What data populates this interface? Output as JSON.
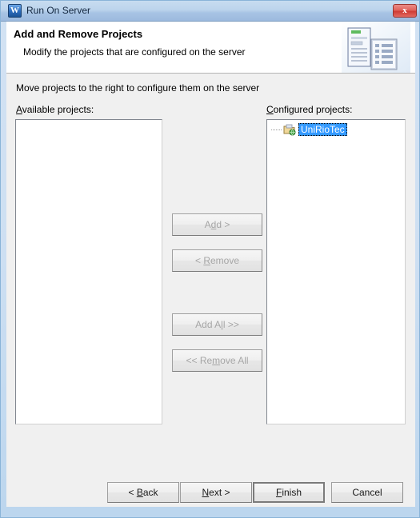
{
  "window": {
    "title": "Run On Server",
    "icon": "web-project-icon",
    "icon_glyph": "W",
    "close_label": "x",
    "close_icon": "close-icon"
  },
  "header": {
    "title": "Add and Remove Projects",
    "subtitle": "Modify the projects that are configured on the server",
    "art_icon": "server-and-document-icon"
  },
  "body": {
    "instruction": "Move projects to the right to configure them on the server",
    "available": {
      "label_pre": "",
      "label_mnemonic": "A",
      "label_post": "vailable projects:",
      "items": []
    },
    "configured": {
      "label_pre": "",
      "label_mnemonic": "C",
      "label_post": "onfigured projects:",
      "items": [
        {
          "name": "UniRioTec",
          "icon": "web-project-icon",
          "selected": true
        }
      ]
    }
  },
  "transfer_buttons": [
    {
      "id": "add",
      "pre": "A",
      "mnemonic": "d",
      "post": "d >",
      "enabled": false
    },
    {
      "id": "remove",
      "pre": "< ",
      "mnemonic": "R",
      "post": "emove",
      "enabled": false
    },
    {
      "id": "add-all",
      "pre": "Add A",
      "mnemonic": "l",
      "post": "l >>",
      "enabled": false
    },
    {
      "id": "remove-all",
      "pre": "<< Re",
      "mnemonic": "m",
      "post": "ove All",
      "enabled": false
    }
  ],
  "footer_buttons": [
    {
      "id": "back",
      "pre": "< ",
      "mnemonic": "B",
      "post": "ack",
      "enabled": true,
      "default": false
    },
    {
      "id": "next",
      "pre": "",
      "mnemonic": "N",
      "post": "ext >",
      "enabled": true,
      "default": false
    },
    {
      "id": "finish",
      "pre": "",
      "mnemonic": "F",
      "post": "inish",
      "enabled": true,
      "default": true
    },
    {
      "id": "cancel",
      "pre": "Cancel",
      "mnemonic": "",
      "post": "",
      "enabled": true,
      "default": false
    }
  ],
  "colors": {
    "selection": "#3399ff",
    "titlebar": "#a8c4e4",
    "dialog_bg": "#f0f0f0",
    "close_red": "#cf3c35"
  }
}
